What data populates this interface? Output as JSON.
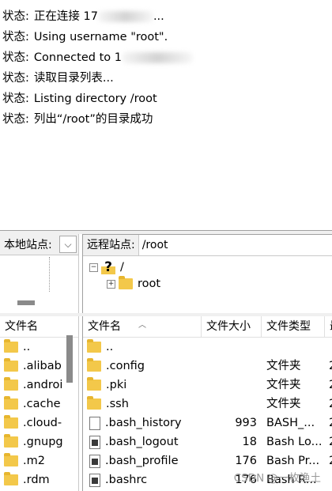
{
  "log": {
    "lines": [
      {
        "label": "状态:",
        "text": "正在连接 17",
        "suffix": "..."
      },
      {
        "label": "状态:",
        "text": "Using username \"root\"."
      },
      {
        "label": "状态:",
        "text": "Connected to 1"
      },
      {
        "label": "状态:",
        "text": "读取目录列表..."
      },
      {
        "label": "状态:",
        "text": "Listing directory /root"
      },
      {
        "label": "状态:",
        "text": "列出“/root”的目录成功"
      }
    ]
  },
  "local_site": {
    "label": "本地站点:",
    "dropdown_glyph": "⌵"
  },
  "remote_site": {
    "label": "远程站点:",
    "path": "/root",
    "tree": [
      {
        "expander": "−",
        "icon": "?",
        "name": "/"
      },
      {
        "expander": "+",
        "name": "root"
      }
    ]
  },
  "local_list": {
    "header": "文件名",
    "items": [
      "..",
      ".alibab",
      ".androi",
      ".cache",
      ".cloud-",
      ".gnupg",
      ".m2",
      ".rdm"
    ]
  },
  "remote_list": {
    "headers": {
      "name": "文件名",
      "size": "文件大小",
      "type": "文件类型",
      "mod": "最"
    },
    "rows": [
      {
        "name": "..",
        "icon": "folder-icon",
        "size": "",
        "type": "",
        "mod": ""
      },
      {
        "name": ".config",
        "icon": "folder-icon",
        "size": "",
        "type": "文件夹",
        "mod": "2"
      },
      {
        "name": ".pki",
        "icon": "folder-icon",
        "size": "",
        "type": "文件夹",
        "mod": "2"
      },
      {
        "name": ".ssh",
        "icon": "folder-icon",
        "size": "",
        "type": "文件夹",
        "mod": "2"
      },
      {
        "name": ".bash_history",
        "icon": "file-icon",
        "size": "993",
        "type": "BASH_...",
        "mod": "2"
      },
      {
        "name": ".bash_logout",
        "icon": "script-file-icon",
        "size": "18",
        "type": "Bash Lo...",
        "mod": "2"
      },
      {
        "name": ".bash_profile",
        "icon": "script-file-icon",
        "size": "176",
        "type": "Bash Pr...",
        "mod": "2"
      },
      {
        "name": ".bashrc",
        "icon": "script-file-icon",
        "size": "176",
        "type": "Bash R...",
        "mod": ""
      }
    ]
  },
  "watermark": "CSDN @一枚渔土"
}
